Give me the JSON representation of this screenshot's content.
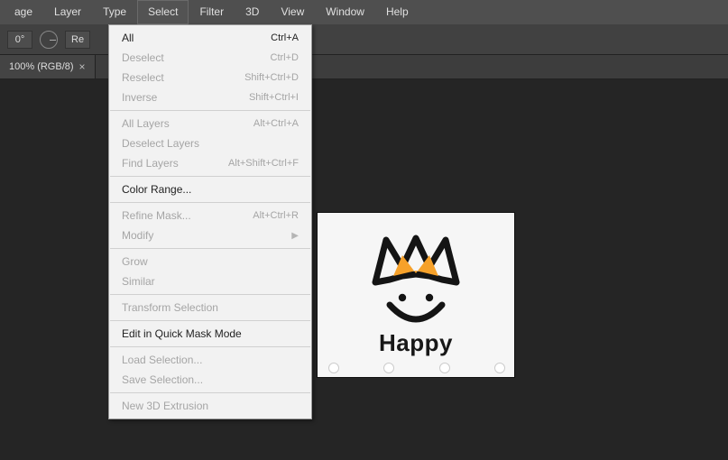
{
  "menubar": {
    "items": [
      "age",
      "Layer",
      "Type",
      "Select",
      "Filter",
      "3D",
      "View",
      "Window",
      "Help"
    ],
    "open_index": 3
  },
  "optionsbar": {
    "angle_value": "0°",
    "reset_btn": "Re"
  },
  "doctab": {
    "title": "100% (RGB/8)",
    "close": "×"
  },
  "dropdown": {
    "groups": [
      [
        {
          "label": "All",
          "shortcut": "Ctrl+A",
          "enabled": true
        },
        {
          "label": "Deselect",
          "shortcut": "Ctrl+D",
          "enabled": false
        },
        {
          "label": "Reselect",
          "shortcut": "Shift+Ctrl+D",
          "enabled": false
        },
        {
          "label": "Inverse",
          "shortcut": "Shift+Ctrl+I",
          "enabled": false
        }
      ],
      [
        {
          "label": "All Layers",
          "shortcut": "Alt+Ctrl+A",
          "enabled": false
        },
        {
          "label": "Deselect Layers",
          "shortcut": "",
          "enabled": false
        },
        {
          "label": "Find Layers",
          "shortcut": "Alt+Shift+Ctrl+F",
          "enabled": false
        }
      ],
      [
        {
          "label": "Color Range...",
          "shortcut": "",
          "enabled": true
        }
      ],
      [
        {
          "label": "Refine Mask...",
          "shortcut": "Alt+Ctrl+R",
          "enabled": false
        },
        {
          "label": "Modify",
          "shortcut": "",
          "enabled": false,
          "submenu": true
        }
      ],
      [
        {
          "label": "Grow",
          "shortcut": "",
          "enabled": false
        },
        {
          "label": "Similar",
          "shortcut": "",
          "enabled": false
        }
      ],
      [
        {
          "label": "Transform Selection",
          "shortcut": "",
          "enabled": false
        }
      ],
      [
        {
          "label": "Edit in Quick Mask Mode",
          "shortcut": "",
          "enabled": true
        }
      ],
      [
        {
          "label": "Load Selection...",
          "shortcut": "",
          "enabled": false
        },
        {
          "label": "Save Selection...",
          "shortcut": "",
          "enabled": false
        }
      ],
      [
        {
          "label": "New 3D Extrusion",
          "shortcut": "",
          "enabled": false
        }
      ]
    ]
  },
  "canvas": {
    "logo_text": "Happy"
  }
}
